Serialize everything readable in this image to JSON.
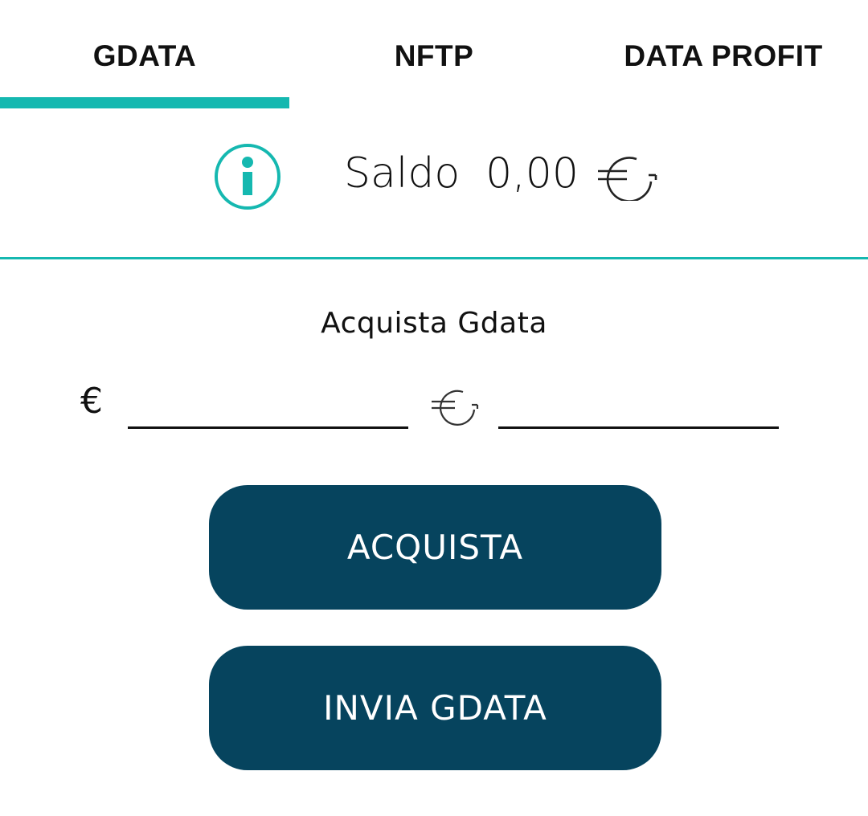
{
  "tabs": [
    {
      "label": "GDATA",
      "active": true
    },
    {
      "label": "NFTP",
      "active": false
    },
    {
      "label": "DATA PROFIT",
      "active": false
    }
  ],
  "balance": {
    "label": "Saldo",
    "amount": "0,00",
    "currency_icon": "gdata-currency-icon"
  },
  "info_icon": "info-icon",
  "purchase": {
    "title": "Acquista Gdata",
    "euro_symbol": "€",
    "euro_input_value": "",
    "gdata_input_value": ""
  },
  "buttons": {
    "buy_label": "ACQUISTA",
    "send_label": "INVIA GDATA"
  },
  "colors": {
    "accent": "#15b8b0",
    "button_bg": "#06445e",
    "button_text": "#ffffff",
    "text": "#111111"
  }
}
